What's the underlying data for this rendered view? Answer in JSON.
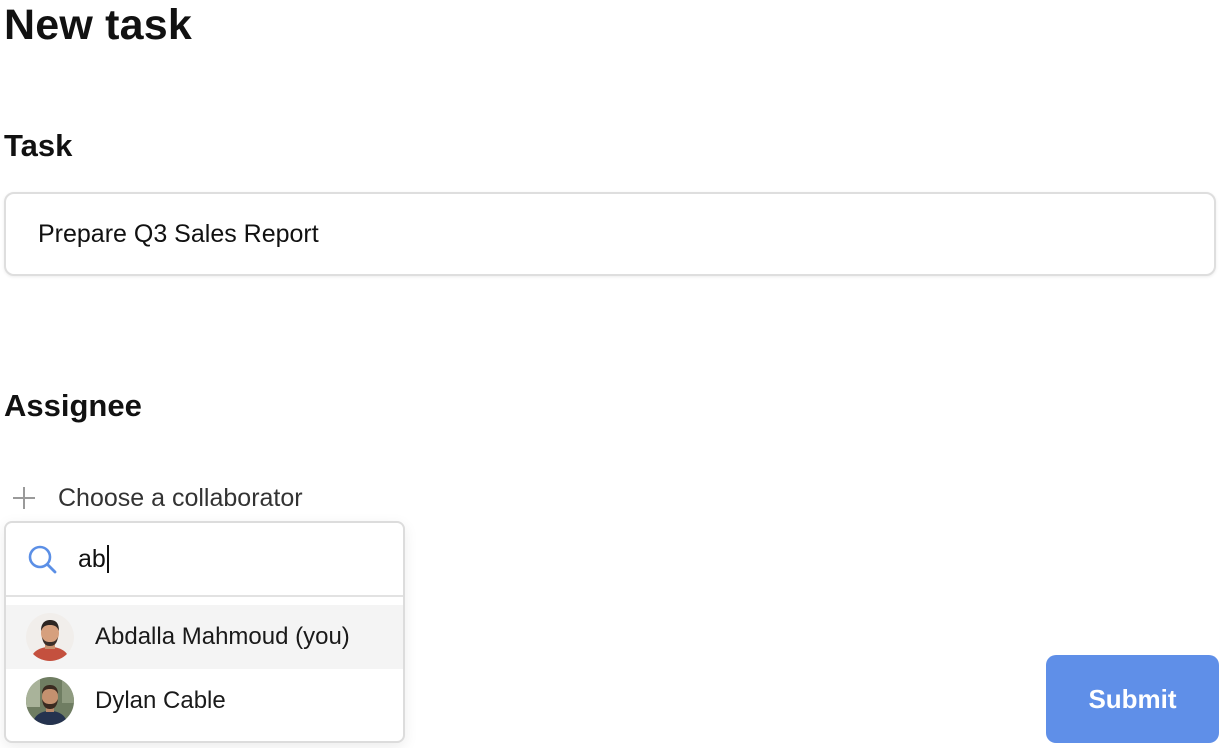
{
  "page": {
    "title": "New task"
  },
  "task": {
    "label": "Task",
    "value": "Prepare Q3 Sales Report"
  },
  "assignee": {
    "label": "Assignee",
    "choose_label": "Choose a collaborator",
    "choose_icon": "plus-icon"
  },
  "dropdown": {
    "search_icon": "search-icon",
    "search_value": "ab",
    "results": [
      {
        "name": "Abdalla Mahmoud (you)",
        "highlighted": true
      },
      {
        "name": "Dylan Cable",
        "highlighted": false
      }
    ]
  },
  "submit": {
    "label": "Submit"
  },
  "colors": {
    "accent": "#5f8fe8",
    "search_icon": "#5b8fe6",
    "highlight": "#f4f4f4"
  }
}
